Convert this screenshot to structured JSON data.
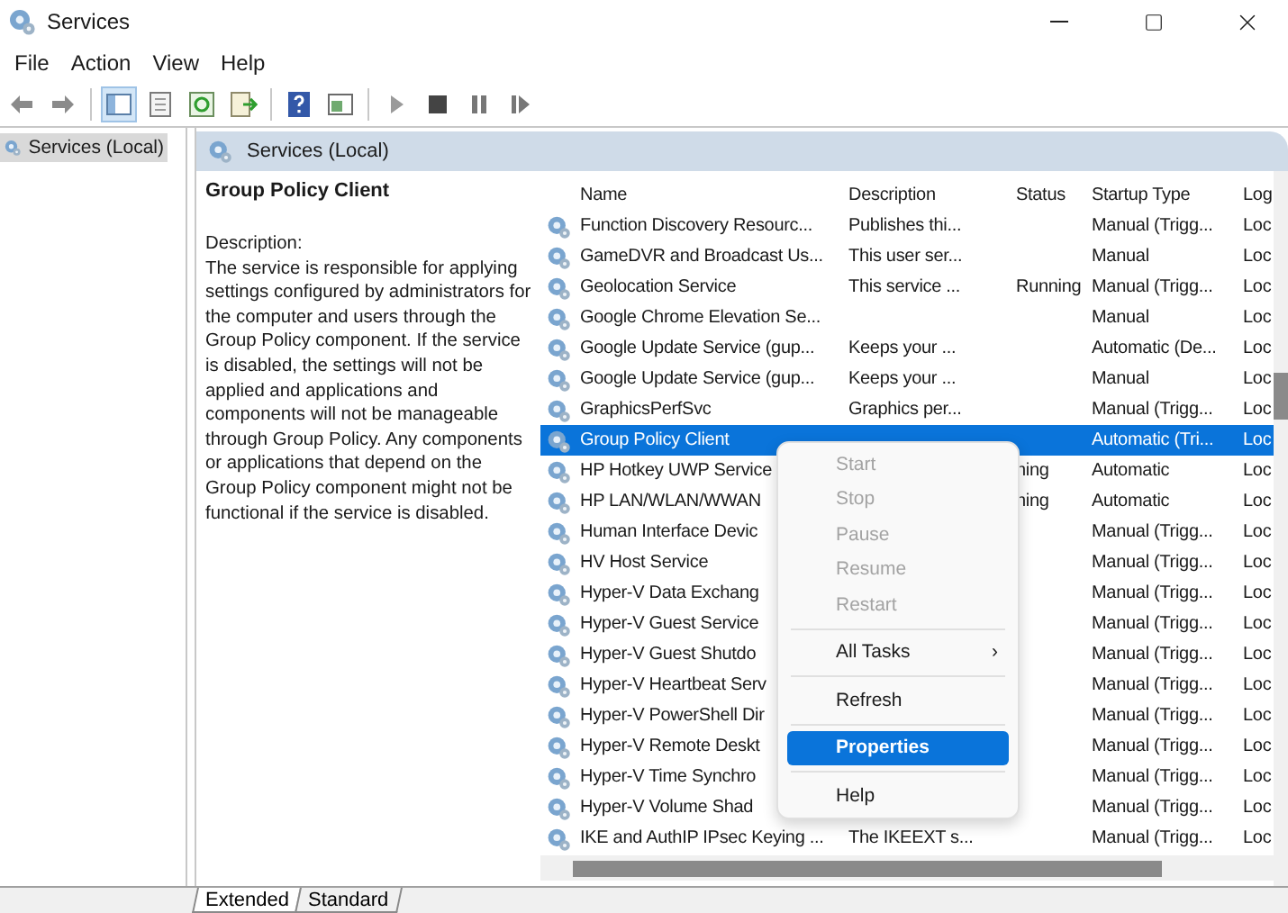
{
  "window": {
    "title": "Services"
  },
  "menu": [
    "File",
    "Action",
    "View",
    "Help"
  ],
  "toolbar": {
    "console_tree_shown": true,
    "items": [
      {
        "kind": "back"
      },
      {
        "kind": "forward"
      },
      {
        "kind": "sep"
      },
      {
        "kind": "tree"
      },
      {
        "kind": "sheet"
      },
      {
        "kind": "refresh"
      },
      {
        "kind": "export"
      },
      {
        "kind": "sep"
      },
      {
        "kind": "help"
      },
      {
        "kind": "view"
      },
      {
        "kind": "sep"
      },
      {
        "kind": "play"
      },
      {
        "kind": "stop"
      },
      {
        "kind": "pause"
      },
      {
        "kind": "resume"
      }
    ]
  },
  "tree": [
    {
      "label": "Services (Local)",
      "selected": true
    }
  ],
  "panel_header": "Services (Local)",
  "details": {
    "title": "Group Policy Client",
    "label": "Description:",
    "text": "The service is responsible for applying settings configured by administrators for the computer and users through the Group Policy component. If the service is disabled, the settings will not be applied and applications and components will not be manageable through Group Policy. Any components or applications that depend on the Group Policy component might not be functional if the service is disabled."
  },
  "table": {
    "columns": [
      "Name",
      "Description",
      "Status",
      "Startup Type",
      "Log"
    ],
    "rows": [
      {
        "name": "Function Discovery Resourc...",
        "description": "Publishes thi...",
        "status": "",
        "startup": "Manual (Trigg...",
        "log": "Loc",
        "selected": false
      },
      {
        "name": "GameDVR and Broadcast Us...",
        "description": "This user ser...",
        "status": "",
        "startup": "Manual",
        "log": "Loc",
        "selected": false
      },
      {
        "name": "Geolocation Service",
        "description": "This service ...",
        "status": "Running",
        "startup": "Manual (Trigg...",
        "log": "Loc",
        "selected": false
      },
      {
        "name": "Google Chrome Elevation Se...",
        "description": "",
        "status": "",
        "startup": "Manual",
        "log": "Loc",
        "selected": false
      },
      {
        "name": "Google Update Service (gup...",
        "description": "Keeps your ...",
        "status": "",
        "startup": "Automatic (De...",
        "log": "Loc",
        "selected": false
      },
      {
        "name": "Google Update Service (gup...",
        "description": "Keeps your ...",
        "status": "",
        "startup": "Manual",
        "log": "Loc",
        "selected": false
      },
      {
        "name": "GraphicsPerfSvc",
        "description": "Graphics per...",
        "status": "",
        "startup": "Manual (Trigg...",
        "log": "Loc",
        "selected": false
      },
      {
        "name": "Group Policy Client",
        "description": "",
        "status": "",
        "startup": "Automatic (Tri...",
        "log": "Loc",
        "selected": true
      },
      {
        "name": "HP Hotkey UWP Service",
        "description": "",
        "status": "ning",
        "startup": "Automatic",
        "log": "Loc",
        "selected": false
      },
      {
        "name": "HP LAN/WLAN/WWAN",
        "description": "",
        "status": "ning",
        "startup": "Automatic",
        "log": "Loc",
        "selected": false
      },
      {
        "name": "Human Interface Devic",
        "description": "",
        "status": "",
        "startup": "Manual (Trigg...",
        "log": "Loc",
        "selected": false
      },
      {
        "name": "HV Host Service",
        "description": "",
        "status": "",
        "startup": "Manual (Trigg...",
        "log": "Loc",
        "selected": false
      },
      {
        "name": "Hyper-V Data Exchang",
        "description": "",
        "status": "",
        "startup": "Manual (Trigg...",
        "log": "Loc",
        "selected": false
      },
      {
        "name": "Hyper-V Guest Service",
        "description": "",
        "status": "",
        "startup": "Manual (Trigg...",
        "log": "Loc",
        "selected": false
      },
      {
        "name": "Hyper-V Guest Shutdo",
        "description": "",
        "status": "",
        "startup": "Manual (Trigg...",
        "log": "Loc",
        "selected": false
      },
      {
        "name": "Hyper-V Heartbeat Serv",
        "description": "",
        "status": "",
        "startup": "Manual (Trigg...",
        "log": "Loc",
        "selected": false
      },
      {
        "name": "Hyper-V PowerShell Dir",
        "description": "",
        "status": "",
        "startup": "Manual (Trigg...",
        "log": "Loc",
        "selected": false
      },
      {
        "name": "Hyper-V Remote Deskt",
        "description": "",
        "status": "",
        "startup": "Manual (Trigg...",
        "log": "Loc",
        "selected": false
      },
      {
        "name": "Hyper-V Time Synchro",
        "description": "",
        "status": "",
        "startup": "Manual (Trigg...",
        "log": "Loc",
        "selected": false
      },
      {
        "name": "Hyper-V Volume Shad",
        "description": "",
        "status": "",
        "startup": "Manual (Trigg...",
        "log": "Loc",
        "selected": false
      },
      {
        "name": "IKE and AuthIP IPsec Keying ...",
        "description": "The IKEEXT s...",
        "status": "",
        "startup": "Manual (Trigg...",
        "log": "Loc",
        "selected": false
      }
    ]
  },
  "context_menu": [
    {
      "kind": "item",
      "label": "Start",
      "disabled": true,
      "selected": false
    },
    {
      "kind": "item",
      "label": "Stop",
      "disabled": true,
      "selected": false
    },
    {
      "kind": "item",
      "label": "Pause",
      "disabled": true,
      "selected": false
    },
    {
      "kind": "item",
      "label": "Resume",
      "disabled": true,
      "selected": false
    },
    {
      "kind": "item",
      "label": "Restart",
      "disabled": true,
      "selected": false
    },
    {
      "kind": "separator"
    },
    {
      "kind": "submenu",
      "label": "All Tasks",
      "arrow": "›",
      "disabled": false,
      "selected": false
    },
    {
      "kind": "separator"
    },
    {
      "kind": "item",
      "label": "Refresh",
      "disabled": false,
      "selected": false
    },
    {
      "kind": "separator"
    },
    {
      "kind": "item",
      "label": "Properties",
      "disabled": false,
      "selected": true
    },
    {
      "kind": "separator"
    },
    {
      "kind": "item",
      "label": "Help",
      "disabled": false,
      "selected": false
    }
  ],
  "tabs": [
    {
      "label": "Extended",
      "selected": true
    },
    {
      "label": "Standard",
      "selected": false
    }
  ]
}
